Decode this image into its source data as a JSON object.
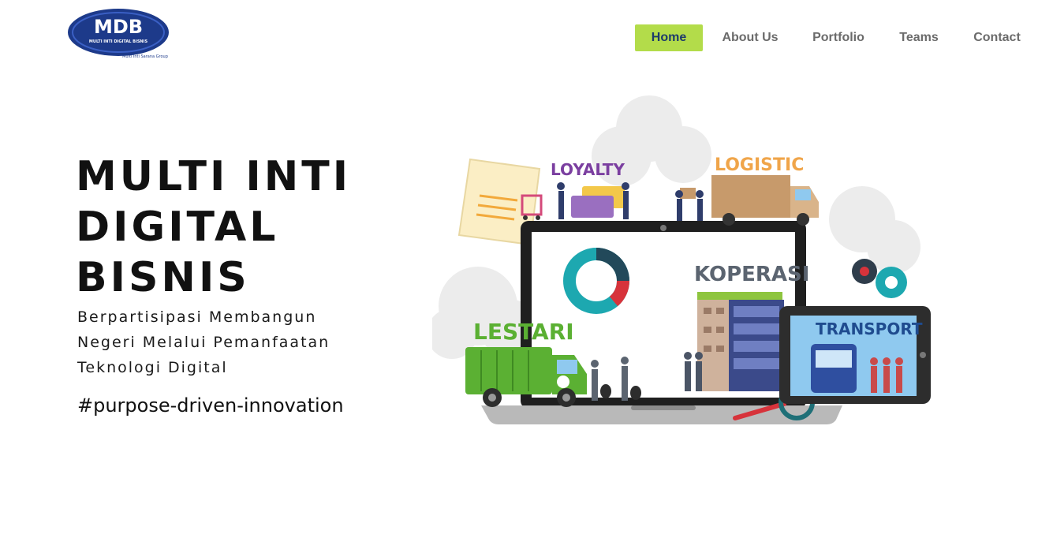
{
  "header": {
    "logo": {
      "mark": "MDB",
      "name": "MULTI INTI DIGITAL BISNIS",
      "group": "Multi Inti Sarana Group"
    },
    "nav": [
      {
        "label": "Home",
        "active": true
      },
      {
        "label": "About Us",
        "active": false
      },
      {
        "label": "Portfolio",
        "active": false
      },
      {
        "label": "Teams",
        "active": false
      },
      {
        "label": "Contact",
        "active": false
      }
    ]
  },
  "hero": {
    "title_lines": [
      "MULTI INTI",
      "DIGITAL",
      "BISNIS"
    ],
    "subtitle_lines": [
      "Berpartisipasi Membangun",
      "Negeri Melalui Pemanfaatan",
      "Teknologi Digital"
    ],
    "tagline": "#purpose-driven-innovation"
  },
  "illustration": {
    "labels": {
      "loyalty": "LOYALTY",
      "logistic": "LOGISTIC",
      "koperasi": "KOPERASI",
      "lestari": "LESTARI",
      "transport": "TRANSPORT"
    }
  },
  "colors": {
    "accent": "#b3dc4a",
    "brand_navy": "#1d3a8a",
    "nav_text": "#6b6b6b",
    "lestari_green": "#5bb033",
    "loyalty_purple": "#7b3fa0",
    "logistic_orange": "#f0a54a",
    "koperasi_gray": "#5b6470",
    "transport_blue": "#1f4b8f"
  }
}
